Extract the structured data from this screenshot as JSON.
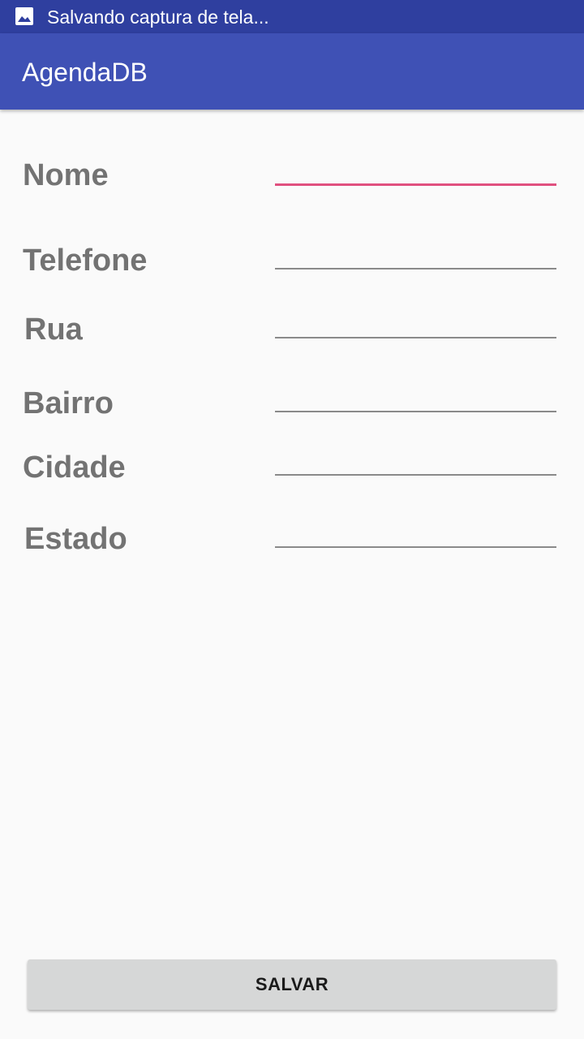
{
  "status_bar": {
    "icon": "image-icon",
    "notification_text": "Salvando captura de tela..."
  },
  "app_bar": {
    "title": "AgendaDB"
  },
  "form": {
    "fields": [
      {
        "label": "Nome",
        "value": "",
        "focused": true
      },
      {
        "label": "Telefone",
        "value": ""
      },
      {
        "label": "Rua",
        "value": ""
      },
      {
        "label": "Bairro",
        "value": ""
      },
      {
        "label": "Cidade",
        "value": ""
      },
      {
        "label": "Estado",
        "value": ""
      }
    ]
  },
  "actions": {
    "save_label": "SALVAR"
  },
  "colors": {
    "status_bar": "#2f3f9f",
    "app_bar": "#3f51b5",
    "accent": "#e0507f",
    "label_text": "#737373",
    "button_bg": "#d6d7d7"
  }
}
